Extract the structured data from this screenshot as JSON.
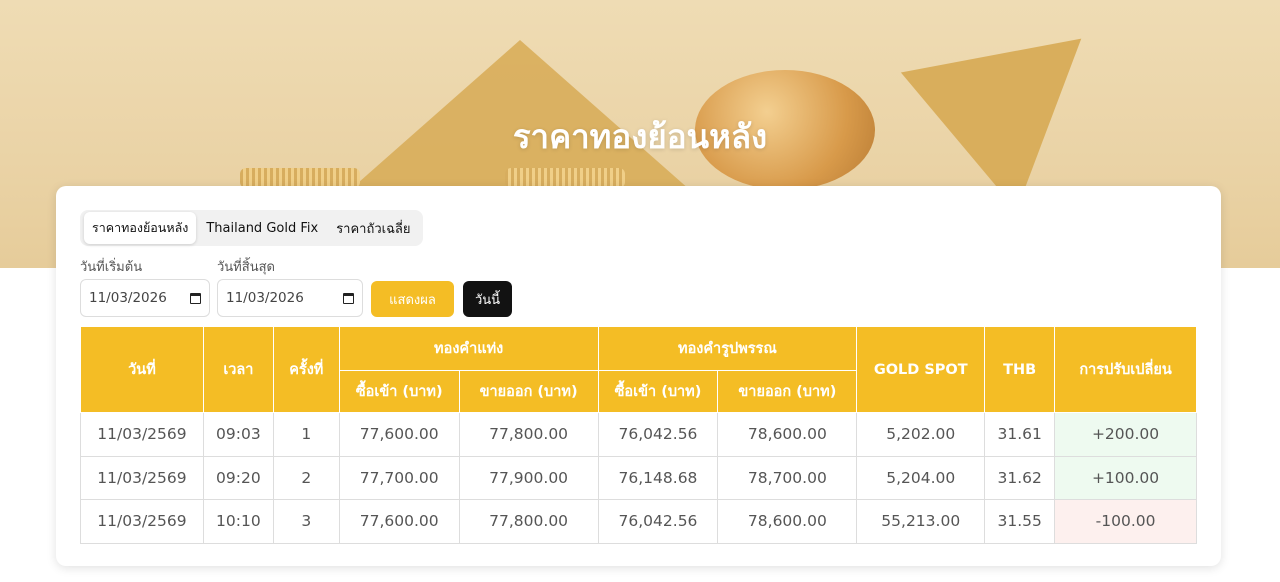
{
  "hero": {
    "title": "ราคาทองย้อนหลัง"
  },
  "tabs": [
    {
      "label": "ราคาทองย้อนหลัง",
      "active": true
    },
    {
      "label": "Thailand Gold Fix",
      "active": false
    },
    {
      "label": "ราคาถัวเฉลี่ย",
      "active": false
    }
  ],
  "filters": {
    "start_label": "วันที่เริ่มต้น",
    "start_value": "11/03/2026",
    "end_label": "วันที่สิ้นสุด",
    "end_value": "11/03/2026",
    "show_button": "แสดงผล",
    "today_button": "วันนี้"
  },
  "table": {
    "headers": {
      "date": "วันที่",
      "time": "เวลา",
      "round": "ครั้งที่",
      "bar_group": "ทองคำแท่ง",
      "ornament_group": "ทองคำรูปพรรณ",
      "buy": "ซื้อเข้า (บาท)",
      "sell": "ขายออก (บาท)",
      "spot": "GOLD SPOT",
      "thb": "THB",
      "change": "การปรับเปลี่ยน"
    },
    "rows": [
      {
        "date": "11/03/2569",
        "time": "09:03",
        "round": "1",
        "bar_buy": "77,600.00",
        "bar_sell": "77,800.00",
        "orn_buy": "76,042.56",
        "orn_sell": "78,600.00",
        "spot": "5,202.00",
        "thb": "31.61",
        "change": "+200.00",
        "dir": "up"
      },
      {
        "date": "11/03/2569",
        "time": "09:20",
        "round": "2",
        "bar_buy": "77,700.00",
        "bar_sell": "77,900.00",
        "orn_buy": "76,148.68",
        "orn_sell": "78,700.00",
        "spot": "5,204.00",
        "thb": "31.62",
        "change": "+100.00",
        "dir": "up"
      },
      {
        "date": "11/03/2569",
        "time": "10:10",
        "round": "3",
        "bar_buy": "77,600.00",
        "bar_sell": "77,800.00",
        "orn_buy": "76,042.56",
        "orn_sell": "78,600.00",
        "spot": "55,213.00",
        "thb": "31.55",
        "change": "-100.00",
        "dir": "down"
      }
    ]
  },
  "colors": {
    "accent": "#f4bd25",
    "positive_bg": "#eefaf0",
    "negative_bg": "#fdf0ee"
  },
  "icons": [
    "calendar-icon"
  ]
}
